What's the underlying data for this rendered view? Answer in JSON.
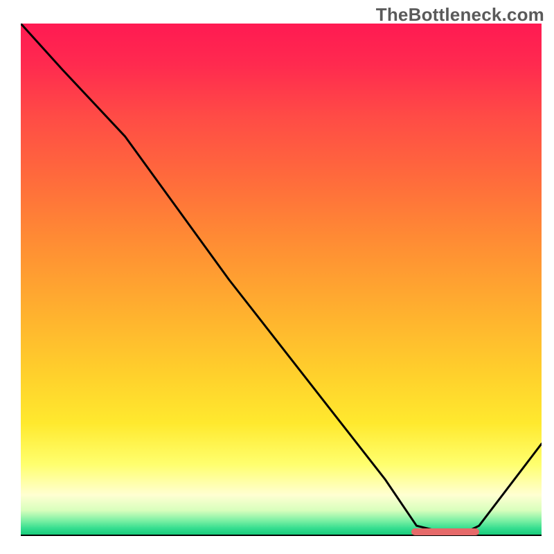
{
  "watermark": "TheBottleneck.com",
  "chart_data": {
    "type": "line",
    "title": "",
    "xlabel": "",
    "ylabel": "",
    "xlim": [
      0,
      100
    ],
    "ylim": [
      0,
      100
    ],
    "grid": false,
    "series": [
      {
        "name": "bottleneck-curve",
        "x": [
          0,
          8,
          20,
          30,
          40,
          50,
          60,
          70,
          76,
          84,
          88,
          100
        ],
        "values": [
          100,
          91,
          78,
          64,
          50,
          37,
          24,
          11,
          2,
          0,
          2,
          18
        ]
      }
    ],
    "marker": {
      "name": "optimal-range",
      "x_start": 75,
      "x_end": 88,
      "y": 0,
      "label": ""
    },
    "background_gradient": {
      "stops": [
        {
          "pos": 0.0,
          "color": "#ff1a52"
        },
        {
          "pos": 0.3,
          "color": "#ff6a3c"
        },
        {
          "pos": 0.68,
          "color": "#ffcf2c"
        },
        {
          "pos": 0.86,
          "color": "#ffff6e"
        },
        {
          "pos": 0.97,
          "color": "#7cf0a4"
        },
        {
          "pos": 1.0,
          "color": "#12c776"
        }
      ]
    }
  }
}
